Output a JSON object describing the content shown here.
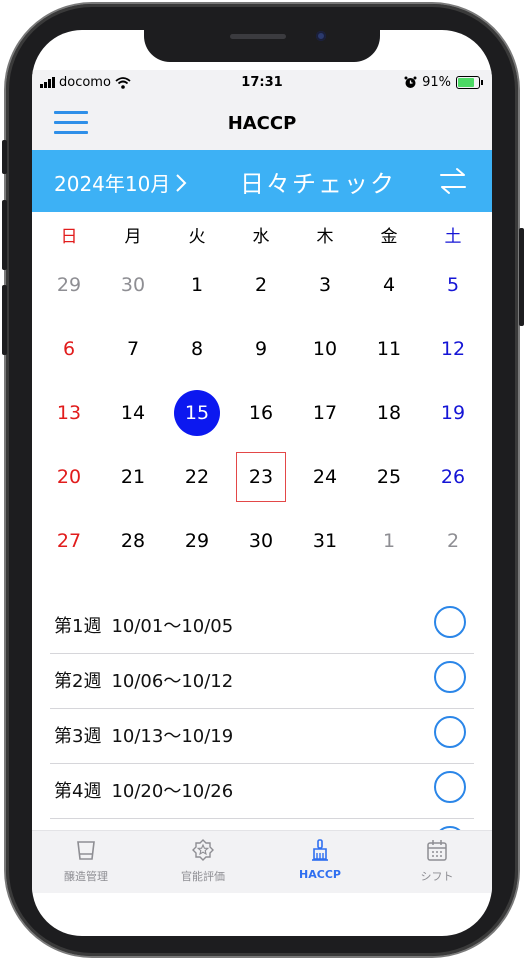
{
  "status_bar": {
    "carrier": "docomo",
    "time": "17:31",
    "battery": "91%",
    "battery_level": 0.91
  },
  "nav": {
    "title": "HACCP"
  },
  "month_bar": {
    "month_label": "2024年10月",
    "chevron": "〉",
    "title": "日々チェック"
  },
  "weekdays": [
    "日",
    "月",
    "火",
    "水",
    "木",
    "金",
    "土"
  ],
  "calendar_rows": [
    [
      "29",
      "30",
      "1",
      "2",
      "3",
      "4",
      "5"
    ],
    [
      "6",
      "7",
      "8",
      "9",
      "10",
      "11",
      "12"
    ],
    [
      "13",
      "14",
      "15",
      "16",
      "17",
      "18",
      "19"
    ],
    [
      "20",
      "21",
      "22",
      "23",
      "24",
      "25",
      "26"
    ],
    [
      "27",
      "28",
      "29",
      "30",
      "31",
      "1",
      "2"
    ]
  ],
  "today": "15",
  "selected": "23",
  "weeks": [
    {
      "label": "第1週",
      "range": "10/01〜10/05"
    },
    {
      "label": "第2週",
      "range": "10/06〜10/12"
    },
    {
      "label": "第3週",
      "range": "10/13〜10/19"
    },
    {
      "label": "第4週",
      "range": "10/20〜10/26"
    }
  ],
  "tabs": [
    {
      "label": "醸造管理",
      "icon": "cup-icon"
    },
    {
      "label": "官能評価",
      "icon": "star-badge-icon"
    },
    {
      "label": "HACCP",
      "icon": "broom-icon"
    },
    {
      "label": "シフト",
      "icon": "calendar-icon"
    }
  ],
  "colors": {
    "accent": "#3db1f5",
    "sunday": "#e11c1c",
    "saturday": "#1515d6",
    "today": "#0c18f0",
    "selected_border": "#e34848",
    "active_tab": "#2f6ff0"
  }
}
